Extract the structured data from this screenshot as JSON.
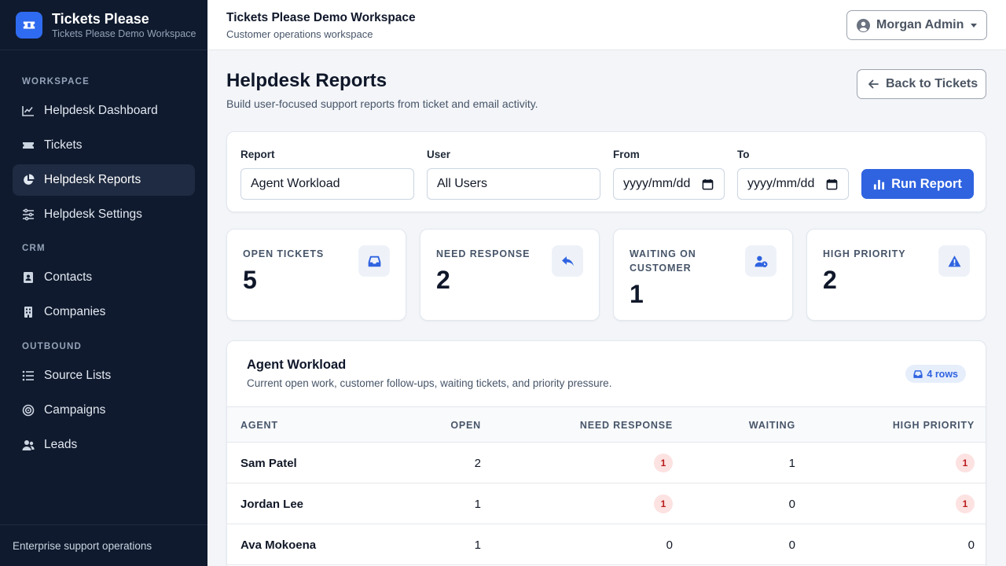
{
  "brand": {
    "name": "Tickets Please",
    "subtitle": "Tickets Please Demo Workspace"
  },
  "sidebar": {
    "sections": [
      {
        "label": "WORKSPACE"
      },
      {
        "label": "CRM"
      },
      {
        "label": "OUTBOUND"
      }
    ],
    "items": [
      {
        "label": "Helpdesk Dashboard",
        "icon": "chart-line-icon"
      },
      {
        "label": "Tickets",
        "icon": "ticket-icon"
      },
      {
        "label": "Helpdesk Reports",
        "icon": "pie-chart-icon",
        "active": true
      },
      {
        "label": "Helpdesk Settings",
        "icon": "sliders-icon"
      },
      {
        "label": "Contacts",
        "icon": "address-book-icon"
      },
      {
        "label": "Companies",
        "icon": "building-icon"
      },
      {
        "label": "Source Lists",
        "icon": "list-icon"
      },
      {
        "label": "Campaigns",
        "icon": "target-icon"
      },
      {
        "label": "Leads",
        "icon": "users-icon"
      }
    ],
    "footer": "Enterprise support operations"
  },
  "topbar": {
    "title": "Tickets Please Demo Workspace",
    "subtitle": "Customer operations workspace",
    "user": "Morgan Admin"
  },
  "page": {
    "title": "Helpdesk Reports",
    "subtitle": "Build user-focused support reports from ticket and email activity.",
    "back_label": "Back to Tickets"
  },
  "filters": {
    "report_label": "Report",
    "report_value": "Agent Workload",
    "user_label": "User",
    "user_value": "All Users",
    "from_label": "From",
    "from_value": "yyyy/mm/dd",
    "to_label": "To",
    "to_value": "yyyy/mm/dd",
    "run_label": "Run Report"
  },
  "stats": [
    {
      "label": "OPEN TICKETS",
      "value": "5",
      "icon": "inbox-icon"
    },
    {
      "label": "NEED RESPONSE",
      "value": "2",
      "icon": "reply-icon"
    },
    {
      "label": "WAITING ON CUSTOMER",
      "value": "1",
      "icon": "user-clock-icon"
    },
    {
      "label": "HIGH PRIORITY",
      "value": "2",
      "icon": "warning-icon"
    }
  ],
  "table": {
    "title": "Agent Workload",
    "subtitle": "Current open work, customer follow-ups, waiting tickets, and priority pressure.",
    "rows_badge": "4 rows",
    "columns": [
      "AGENT",
      "OPEN",
      "NEED RESPONSE",
      "WAITING",
      "HIGH PRIORITY"
    ],
    "rows": [
      {
        "agent": "Sam Patel",
        "open": "2",
        "need_response": "1",
        "waiting": "1",
        "high_priority": "1"
      },
      {
        "agent": "Jordan Lee",
        "open": "1",
        "need_response": "1",
        "waiting": "0",
        "high_priority": "1"
      },
      {
        "agent": "Ava Mokoena",
        "open": "1",
        "need_response": "0",
        "waiting": "0",
        "high_priority": "0"
      }
    ]
  },
  "colors": {
    "sidebar_bg": "#0f1a2e",
    "accent": "#2f63e0",
    "pill_bg": "#fde2e2",
    "pill_text": "#b91c1c"
  }
}
